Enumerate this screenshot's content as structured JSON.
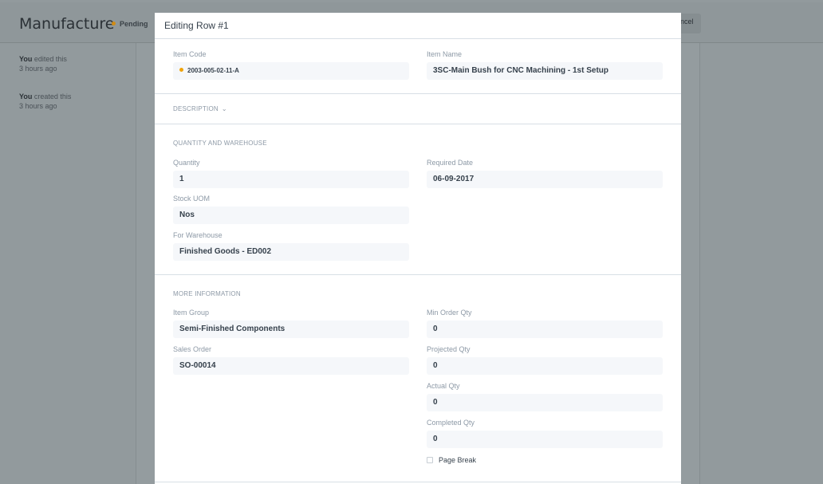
{
  "background": {
    "title": "Manufacture",
    "status": "Pending",
    "cancel_label": "ncel",
    "timeline": [
      {
        "user": "You",
        "action": " edited this",
        "time": "3 hours ago"
      },
      {
        "user": "You",
        "action": " created this",
        "time": "3 hours ago"
      }
    ]
  },
  "modal": {
    "title": "Editing Row #1",
    "item_code": {
      "label": "Item Code",
      "value": "2003-005-02-11-A"
    },
    "item_name": {
      "label": "Item Name",
      "value": "3SC-Main Bush for CNC Machining - 1st Setup"
    },
    "description_label": "DESCRIPTION",
    "qty_section": {
      "title": "QUANTITY AND WAREHOUSE",
      "quantity": {
        "label": "Quantity",
        "value": "1"
      },
      "required_date": {
        "label": "Required Date",
        "value": "06-09-2017"
      },
      "stock_uom": {
        "label": "Stock UOM",
        "value": "Nos"
      },
      "for_warehouse": {
        "label": "For Warehouse",
        "value": "Finished Goods - ED002"
      }
    },
    "more_section": {
      "title": "MORE INFORMATION",
      "item_group": {
        "label": "Item Group",
        "value": "Semi-Finished Components"
      },
      "sales_order": {
        "label": "Sales Order",
        "value": "SO-00014"
      },
      "min_order_qty": {
        "label": "Min Order Qty",
        "value": "0"
      },
      "projected_qty": {
        "label": "Projected Qty",
        "value": "0"
      },
      "actual_qty": {
        "label": "Actual Qty",
        "value": "0"
      },
      "completed_qty": {
        "label": "Completed Qty",
        "value": "0"
      },
      "page_break": {
        "label": "Page Break",
        "checked": false
      }
    }
  }
}
